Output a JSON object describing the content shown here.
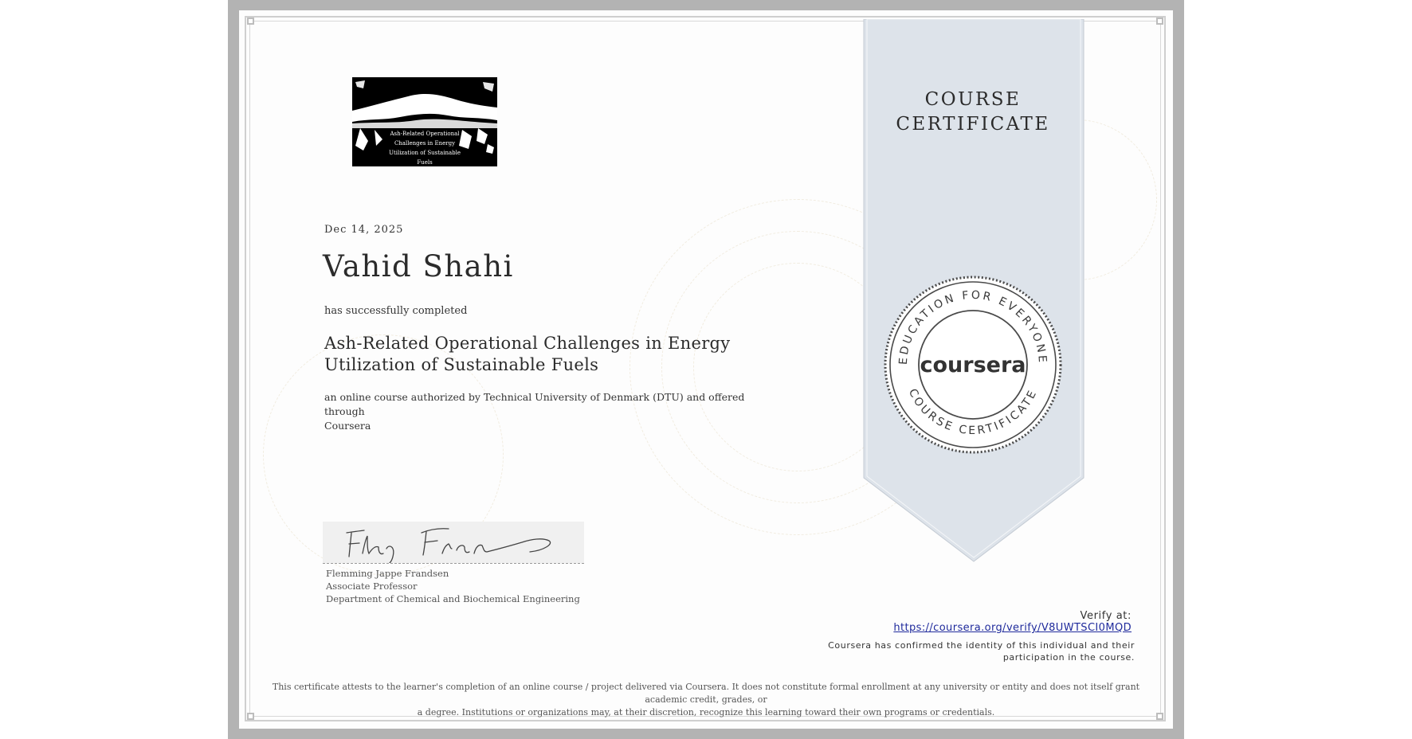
{
  "certificate": {
    "badge_line1": "COURSE",
    "badge_line2": "CERTIFICATE",
    "date": "Dec 14, 2025",
    "recipient": "Vahid Shahi",
    "completed_text": "has successfully completed",
    "course_title_line1": "Ash-Related Operational Challenges in Energy",
    "course_title_line2": "Utilization of Sustainable Fuels",
    "authorized_line1": "an online course authorized by Technical University of Denmark (DTU) and offered through",
    "authorized_line2": "Coursera"
  },
  "logo": {
    "caption_line1": "Ash-Related Operational",
    "caption_line2": "Challenges in Energy",
    "caption_line3": "Utilization of Sustainable",
    "caption_line4": "Fuels"
  },
  "seal": {
    "top_text": "EDUCATION FOR EVERYONE",
    "bottom_text": "COURSE CERTIFICATE",
    "brand": "coursera"
  },
  "signer": {
    "name": "Flemming Jappe Frandsen",
    "title": "Associate Professor",
    "department": "Department of Chemical and Biochemical Engineering"
  },
  "verify": {
    "label": "Verify at:",
    "url": "https://coursera.org/verify/V8UWTSCI0MQD",
    "note_line1": "Coursera has confirmed the identity of this individual and their",
    "note_line2": "participation in the course."
  },
  "footer": {
    "line1": "This certificate attests to the learner's completion of an online course / project delivered via Coursera. It does not constitute formal enrollment at any university or entity and does not itself grant academic credit, grades, or",
    "line2": "a degree. Institutions or organizations may, at their discretion, recognize this learning toward their own programs or credentials."
  },
  "colors": {
    "frame_grey": "#b3b3b3",
    "ribbon": "#dde3ea",
    "link": "#1f2a9c",
    "seal_text": "#3a3a3a"
  }
}
